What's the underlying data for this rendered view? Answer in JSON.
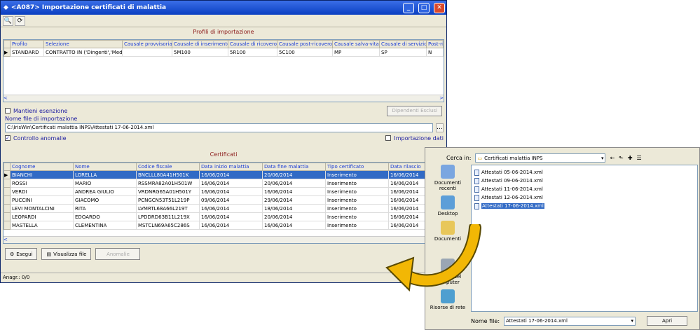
{
  "window": {
    "title": "<A087> Importazione certificati di malattia",
    "minimize": "_",
    "maximize": "□",
    "close": "✕"
  },
  "toolbar": {
    "zoom_icon": "magnifier-icon",
    "refresh_icon": "refresh-icon"
  },
  "profiles": {
    "heading": "Profili di importazione",
    "columns": [
      "Profilo",
      "Selezione",
      "Causale provvisoria",
      "Causale di inserimento",
      "Causale di ricovero",
      "Causale post-ricovero",
      "Causale salva-vita",
      "Causale di servizio",
      "Post-ric"
    ],
    "rows": [
      [
        "STANDARD",
        "CONTRATTO IN ('Dingenti','Med",
        "",
        "5M100",
        "5R100",
        "5C100",
        "MP",
        "SP",
        "N"
      ]
    ]
  },
  "options": {
    "mantieni": "Mantieni esenzione",
    "dipendenti": "Dipendenti Esclusi",
    "nome_file_label": "Nome file di importazione",
    "nome_file_value": "C:\\IrisWin\\Certificati malattia INPS\\Attestati 17-06-2014.xml",
    "controllo": "Controllo anomalie",
    "importazione": "Importazione  dati"
  },
  "certificati": {
    "heading": "Certificati",
    "columns": [
      "Cognome",
      "Nome",
      "Codice fiscale",
      "Data inizio malattia",
      "Data fine malattia",
      "Tipo certificato",
      "Data rilascio"
    ],
    "rows": [
      [
        "BIANCHI",
        "LORELLA",
        "BNCLLL80A41H501K",
        "16/06/2014",
        "20/06/2014",
        "Inserimento",
        "16/06/2014"
      ],
      [
        "ROSSI",
        "MARIO",
        "RSSMRA82A01H501W",
        "16/06/2014",
        "20/06/2014",
        "Inserimento",
        "16/06/2014"
      ],
      [
        "VERDI",
        "ANDREA GIULIO",
        "VRDNRG65A01H501Y",
        "16/06/2014",
        "16/06/2014",
        "Inserimento",
        "16/06/2014"
      ],
      [
        "PUCCINI",
        "GIACOMO",
        "PCNGCN53T51L219P",
        "09/06/2014",
        "29/06/2014",
        "Inserimento",
        "16/06/2014"
      ],
      [
        "LEVI MONTALCINI",
        "RITA",
        "LVMRTL68A66L219T",
        "16/06/2014",
        "18/06/2014",
        "Inserimento",
        "16/06/2014"
      ],
      [
        "LEOPARDI",
        "EDOARDO",
        "LPDDRD63B11L219X",
        "16/06/2014",
        "20/06/2014",
        "Inserimento",
        "16/06/2014"
      ],
      [
        "MASTELLA",
        "CLEMENTINA",
        "MSTCLN69A65C286S",
        "16/06/2014",
        "16/06/2014",
        "Inserimento",
        "16/06/2014"
      ]
    ]
  },
  "buttons": {
    "esegui": "Esegui",
    "visualizza": "Visualizza file",
    "anomalie": "Anomalie"
  },
  "status": "Anagr.: 0/0",
  "dialog": {
    "cerca_label": "Cerca in:",
    "folder": "Certificati malattia INPS",
    "places": [
      "Documenti recenti",
      "Desktop",
      "Documenti",
      "Risorse del computer",
      "Risorse di rete"
    ],
    "files": [
      "Attestati 05-06-2014.xml",
      "Attestati 09-06-2014.xml",
      "Attestati 11-06-2014.xml",
      "Attestati 12-06-2014.xml",
      "Attestati 17-06-2014.xml"
    ],
    "nome_file_label": "Nome file:",
    "nome_file_value": "Attestati 17-06-2014.xml",
    "apri": "Apri"
  },
  "colors": {
    "title": "#0a3fc1",
    "selection": "#316ac5",
    "arrow": "#f2b705"
  }
}
